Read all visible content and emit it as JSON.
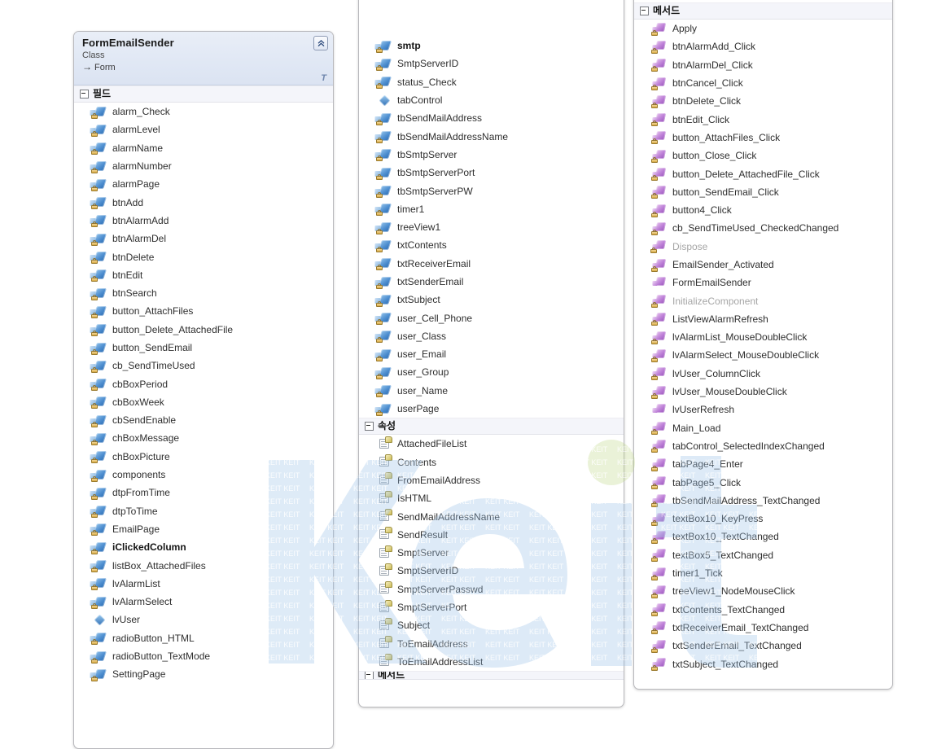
{
  "diagram": {
    "title": "FormEmailSender",
    "kind": "Class",
    "base": "Form",
    "base_arrow_glyph": "→",
    "filter_icon_glyph": "T",
    "collapse_icon": "chevron-up-double-icon",
    "watermark_text": "Keit",
    "watermark_tile_text": "KEIT",
    "colors": {
      "header_gradient_top": "#e9eef7",
      "header_gradient_bottom": "#dbe3f2",
      "panel_border": "#b8b8bc",
      "section_bg": "#f4f5fa",
      "field_icon": "#2f6fb5",
      "property_icon": "#cdbd5b",
      "method_icon": "#9b55bd",
      "watermark_blue": "#aacbe8",
      "watermark_green": "#c9dd9a",
      "member_text": "#5d5d5d",
      "member_text_dark": "#141414",
      "member_text_dim": "#a6a6a6"
    }
  },
  "panels": {
    "fields_panel": {
      "section_label": "필드",
      "members": [
        {
          "name": "alarm_Check",
          "icon": "field-private-icon",
          "tone": "normal"
        },
        {
          "name": "alarmLevel",
          "icon": "field-private-icon",
          "tone": "normal"
        },
        {
          "name": "alarmName",
          "icon": "field-private-icon",
          "tone": "normal"
        },
        {
          "name": "alarmNumber",
          "icon": "field-private-icon",
          "tone": "normal"
        },
        {
          "name": "alarmPage",
          "icon": "field-private-icon",
          "tone": "normal"
        },
        {
          "name": "btnAdd",
          "icon": "field-private-icon",
          "tone": "normal"
        },
        {
          "name": "btnAlarmAdd",
          "icon": "field-private-icon",
          "tone": "normal"
        },
        {
          "name": "btnAlarmDel",
          "icon": "field-private-icon",
          "tone": "normal"
        },
        {
          "name": "btnDelete",
          "icon": "field-private-icon",
          "tone": "normal"
        },
        {
          "name": "btnEdit",
          "icon": "field-private-icon",
          "tone": "normal"
        },
        {
          "name": "btnSearch",
          "icon": "field-private-icon",
          "tone": "normal"
        },
        {
          "name": "button_AttachFiles",
          "icon": "field-private-icon",
          "tone": "normal"
        },
        {
          "name": "button_Delete_AttachedFile",
          "icon": "field-private-icon",
          "tone": "normal"
        },
        {
          "name": "button_SendEmail",
          "icon": "field-private-icon",
          "tone": "normal"
        },
        {
          "name": "cb_SendTimeUsed",
          "icon": "field-private-icon",
          "tone": "normal"
        },
        {
          "name": "cbBoxPeriod",
          "icon": "field-private-icon",
          "tone": "normal"
        },
        {
          "name": "cbBoxWeek",
          "icon": "field-private-icon",
          "tone": "normal"
        },
        {
          "name": "cbSendEnable",
          "icon": "field-private-icon",
          "tone": "normal"
        },
        {
          "name": "chBoxMessage",
          "icon": "field-private-icon",
          "tone": "normal"
        },
        {
          "name": "chBoxPicture",
          "icon": "field-private-icon",
          "tone": "normal"
        },
        {
          "name": "components",
          "icon": "field-private-icon",
          "tone": "normal"
        },
        {
          "name": "dtpFromTime",
          "icon": "field-private-icon",
          "tone": "normal"
        },
        {
          "name": "dtpToTime",
          "icon": "field-private-icon",
          "tone": "normal"
        },
        {
          "name": "EmailPage",
          "icon": "field-private-icon",
          "tone": "normal"
        },
        {
          "name": "iClickedColumn",
          "icon": "field-private-icon",
          "tone": "dark"
        },
        {
          "name": "listBox_AttachedFiles",
          "icon": "field-private-icon",
          "tone": "normal"
        },
        {
          "name": "lvAlarmList",
          "icon": "field-private-icon",
          "tone": "normal"
        },
        {
          "name": "lvAlarmSelect",
          "icon": "field-private-icon",
          "tone": "normal"
        },
        {
          "name": "lvUser",
          "icon": "field-public-icon",
          "tone": "normal"
        },
        {
          "name": "radioButton_HTML",
          "icon": "field-private-icon",
          "tone": "normal"
        },
        {
          "name": "radioButton_TextMode",
          "icon": "field-private-icon",
          "tone": "normal"
        },
        {
          "name": "SettingPage",
          "icon": "field-private-icon",
          "tone": "normal"
        }
      ]
    },
    "props_panel": {
      "fields_continued": [
        {
          "name": "smtp",
          "icon": "field-private-icon",
          "tone": "dark"
        },
        {
          "name": "SmtpServerID",
          "icon": "field-private-icon",
          "tone": "normal"
        },
        {
          "name": "status_Check",
          "icon": "field-private-icon",
          "tone": "normal"
        },
        {
          "name": "tabControl",
          "icon": "field-public-icon",
          "tone": "normal"
        },
        {
          "name": "tbSendMailAddress",
          "icon": "field-private-icon",
          "tone": "normal"
        },
        {
          "name": "tbSendMailAddressName",
          "icon": "field-private-icon",
          "tone": "normal"
        },
        {
          "name": "tbSmtpServer",
          "icon": "field-private-icon",
          "tone": "normal"
        },
        {
          "name": "tbSmtpServerPort",
          "icon": "field-private-icon",
          "tone": "normal"
        },
        {
          "name": "tbSmtpServerPW",
          "icon": "field-private-icon",
          "tone": "normal"
        },
        {
          "name": "timer1",
          "icon": "field-private-icon",
          "tone": "normal"
        },
        {
          "name": "treeView1",
          "icon": "field-private-icon",
          "tone": "normal"
        },
        {
          "name": "txtContents",
          "icon": "field-private-icon",
          "tone": "normal"
        },
        {
          "name": "txtReceiverEmail",
          "icon": "field-private-icon",
          "tone": "normal"
        },
        {
          "name": "txtSenderEmail",
          "icon": "field-private-icon",
          "tone": "normal"
        },
        {
          "name": "txtSubject",
          "icon": "field-private-icon",
          "tone": "normal"
        },
        {
          "name": "user_Cell_Phone",
          "icon": "field-private-icon",
          "tone": "normal"
        },
        {
          "name": "user_Class",
          "icon": "field-private-icon",
          "tone": "normal"
        },
        {
          "name": "user_Email",
          "icon": "field-private-icon",
          "tone": "normal"
        },
        {
          "name": "user_Group",
          "icon": "field-private-icon",
          "tone": "normal"
        },
        {
          "name": "user_Name",
          "icon": "field-private-icon",
          "tone": "normal"
        },
        {
          "name": "userPage",
          "icon": "field-private-icon",
          "tone": "normal"
        }
      ],
      "section_label": "속성",
      "members": [
        {
          "name": "AttachedFileList",
          "icon": "property-icon",
          "tone": "normal"
        },
        {
          "name": "Contents",
          "icon": "property-icon",
          "tone": "normal"
        },
        {
          "name": "FromEmailAddress",
          "icon": "property-icon",
          "tone": "normal"
        },
        {
          "name": "IsHTML",
          "icon": "property-icon",
          "tone": "normal"
        },
        {
          "name": "SendMailAddressName",
          "icon": "property-icon",
          "tone": "normal"
        },
        {
          "name": "SendResult",
          "icon": "property-icon",
          "tone": "normal"
        },
        {
          "name": "SmptServer",
          "icon": "property-icon",
          "tone": "normal"
        },
        {
          "name": "SmptServerID",
          "icon": "property-icon",
          "tone": "normal"
        },
        {
          "name": "SmptServerPasswd",
          "icon": "property-icon",
          "tone": "normal"
        },
        {
          "name": "SmptServerPort",
          "icon": "property-icon",
          "tone": "normal"
        },
        {
          "name": "Subject",
          "icon": "property-icon",
          "tone": "normal"
        },
        {
          "name": "ToEmailAddress",
          "icon": "property-icon",
          "tone": "normal"
        },
        {
          "name": "ToEmailAddressList",
          "icon": "property-icon",
          "tone": "normal"
        }
      ],
      "partial_section_label": "메서드"
    },
    "methods_panel": {
      "section_label": "메서드",
      "members": [
        {
          "name": "Apply",
          "icon": "method-private-icon",
          "tone": "normal"
        },
        {
          "name": "btnAlarmAdd_Click",
          "icon": "method-private-icon",
          "tone": "normal"
        },
        {
          "name": "btnAlarmDel_Click",
          "icon": "method-private-icon",
          "tone": "normal"
        },
        {
          "name": "btnCancel_Click",
          "icon": "method-private-icon",
          "tone": "normal"
        },
        {
          "name": "btnDelete_Click",
          "icon": "method-private-icon",
          "tone": "normal"
        },
        {
          "name": "btnEdit_Click",
          "icon": "method-private-icon",
          "tone": "normal"
        },
        {
          "name": "button_AttachFiles_Click",
          "icon": "method-private-icon",
          "tone": "normal"
        },
        {
          "name": "button_Close_Click",
          "icon": "method-private-icon",
          "tone": "normal"
        },
        {
          "name": "button_Delete_AttachedFile_Click",
          "icon": "method-private-icon",
          "tone": "normal"
        },
        {
          "name": "button_SendEmail_Click",
          "icon": "method-private-icon",
          "tone": "normal"
        },
        {
          "name": "button4_Click",
          "icon": "method-private-icon",
          "tone": "normal"
        },
        {
          "name": "cb_SendTimeUsed_CheckedChanged",
          "icon": "method-private-icon",
          "tone": "normal"
        },
        {
          "name": "Dispose",
          "icon": "method-protected-icon",
          "tone": "dim"
        },
        {
          "name": "EmailSender_Activated",
          "icon": "method-private-icon",
          "tone": "normal"
        },
        {
          "name": "FormEmailSender",
          "icon": "method-public-icon",
          "tone": "normal"
        },
        {
          "name": "InitializeComponent",
          "icon": "method-private-icon",
          "tone": "dim"
        },
        {
          "name": "ListViewAlarmRefresh",
          "icon": "method-private-icon",
          "tone": "normal"
        },
        {
          "name": "lvAlarmList_MouseDoubleClick",
          "icon": "method-private-icon",
          "tone": "normal"
        },
        {
          "name": "lvAlarmSelect_MouseDoubleClick",
          "icon": "method-private-icon",
          "tone": "normal"
        },
        {
          "name": "lvUser_ColumnClick",
          "icon": "method-private-icon",
          "tone": "normal"
        },
        {
          "name": "lvUser_MouseDoubleClick",
          "icon": "method-private-icon",
          "tone": "normal"
        },
        {
          "name": "lvUserRefresh",
          "icon": "method-public-icon",
          "tone": "normal"
        },
        {
          "name": "Main_Load",
          "icon": "method-private-icon",
          "tone": "normal"
        },
        {
          "name": "tabControl_SelectedIndexChanged",
          "icon": "method-private-icon",
          "tone": "normal"
        },
        {
          "name": "tabPage4_Enter",
          "icon": "method-private-icon",
          "tone": "normal"
        },
        {
          "name": "tabPage5_Click",
          "icon": "method-private-icon",
          "tone": "normal"
        },
        {
          "name": "tbSendMailAddress_TextChanged",
          "icon": "method-private-icon",
          "tone": "normal"
        },
        {
          "name": "textBox10_KeyPress",
          "icon": "method-private-icon",
          "tone": "normal"
        },
        {
          "name": "textBox10_TextChanged",
          "icon": "method-private-icon",
          "tone": "normal"
        },
        {
          "name": "textBox5_TextChanged",
          "icon": "method-private-icon",
          "tone": "normal"
        },
        {
          "name": "timer1_Tick",
          "icon": "method-private-icon",
          "tone": "normal"
        },
        {
          "name": "treeView1_NodeMouseClick",
          "icon": "method-private-icon",
          "tone": "normal"
        },
        {
          "name": "txtContents_TextChanged",
          "icon": "method-private-icon",
          "tone": "normal"
        },
        {
          "name": "txtReceiverEmail_TextChanged",
          "icon": "method-private-icon",
          "tone": "normal"
        },
        {
          "name": "txtSenderEmail_TextChanged",
          "icon": "method-private-icon",
          "tone": "normal"
        },
        {
          "name": "txtSubject_TextChanged",
          "icon": "method-private-icon",
          "tone": "normal"
        }
      ]
    }
  }
}
